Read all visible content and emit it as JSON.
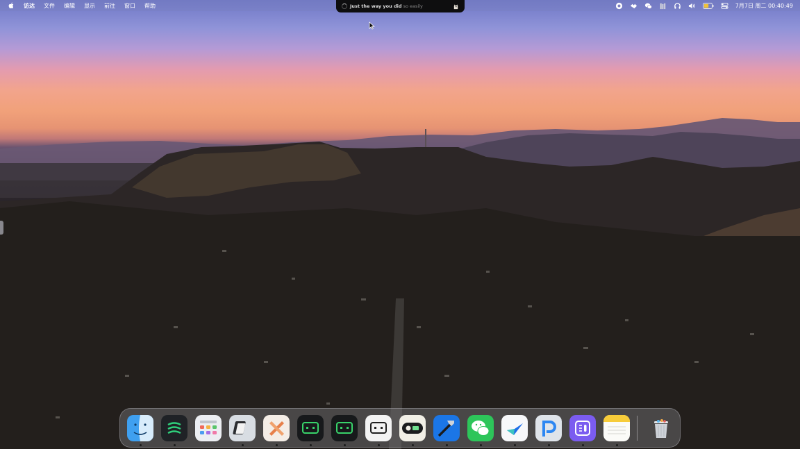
{
  "menubar": {
    "items": [
      "访达",
      "文件",
      "编辑",
      "显示",
      "前往",
      "窗口",
      "帮助"
    ],
    "clock": "7月7日 周二 00:40:49"
  },
  "now_playing": {
    "title": "Just the way you did",
    "rest": " so easily"
  },
  "battery": {
    "level_fraction": 0.6,
    "color": "#f0c23a"
  },
  "dock": {
    "apps": [
      {
        "name": "finder-icon",
        "running": true
      },
      {
        "name": "spotify-like-icon",
        "running": true
      },
      {
        "name": "launchpad-icon",
        "running": false
      },
      {
        "name": "parallels-icon",
        "running": true
      },
      {
        "name": "toolbox-icon",
        "running": true
      },
      {
        "name": "terminal-green-icon",
        "running": true
      },
      {
        "name": "terminal-green-2-icon",
        "running": true
      },
      {
        "name": "terminal-white-icon",
        "running": true
      },
      {
        "name": "tape-icon",
        "running": true
      },
      {
        "name": "xcode-icon",
        "running": true
      },
      {
        "name": "wechat-icon",
        "running": true
      },
      {
        "name": "lark-icon",
        "running": true
      },
      {
        "name": "pockity-icon",
        "running": true
      },
      {
        "name": "teams-like-icon",
        "running": true
      },
      {
        "name": "notes-icon",
        "running": true
      },
      {
        "name": "trash-icon",
        "running": false
      }
    ]
  }
}
